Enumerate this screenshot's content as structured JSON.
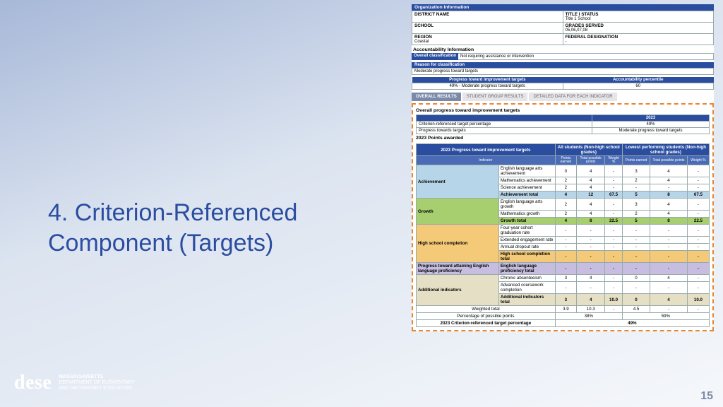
{
  "title": "4. Criterion-Referenced Component (Targets)",
  "page_number": "15",
  "logo": {
    "word": "dese",
    "line1": "MASSACHUSETTS",
    "line2": "Department of Elementary",
    "line3": "and Secondary Education"
  },
  "org": {
    "header": "Organization Information",
    "rows": [
      {
        "l": "DISTRICT NAME",
        "lv": "",
        "r": "TITLE I STATUS",
        "rv": "Title 1 School"
      },
      {
        "l": "SCHOOL",
        "lv": "",
        "r": "GRADES SERVED",
        "rv": "05,06,07,08"
      },
      {
        "l": "REGION",
        "lv": "Coastal",
        "r": "FEDERAL DESIGNATION",
        "rv": "-"
      }
    ]
  },
  "acct": {
    "title": "Accountability Information",
    "overall_label": "Overall classification",
    "overall_value": "Not requiring assistance or intervention",
    "reason_label": "Reason for classification",
    "reason_value": "Moderate progress toward targets",
    "col1_hdr": "Progress toward improvement targets",
    "col1_val": "49% - Moderate progress toward targets",
    "col2_hdr": "Accountability percentile",
    "col2_val": "60"
  },
  "tabs": {
    "t1": "OVERALL RESULTS",
    "t2": "STUDENT GROUP RESULTS",
    "t3": "DETAILED DATA FOR EACH INDICATOR"
  },
  "overall": {
    "title": "Overall progress toward improvement targets",
    "year": "2023",
    "r1_label": "Criterion-referenced target percentage",
    "r1_val": "49%",
    "r2_label": "Progress towards targets",
    "r2_val": "Moderate progress toward targets"
  },
  "points_title": "2023 Points awarded",
  "pts": {
    "main_hdr": "2023 Progress toward improvement targets",
    "indicator": "Indicator",
    "grp1": "All students\n(Non-high school grades)",
    "grp2": "Lowest performing students\n(Non-high school grades)",
    "cols": [
      "Points earned",
      "Total possible points",
      "Weight %",
      "Points earned",
      "Total possible points",
      "Weight %"
    ],
    "cats": {
      "ach": {
        "name": "Achievement",
        "rows": [
          {
            "n": "English language arts achievement",
            "v": [
              "0",
              "4",
              "-",
              "3",
              "4",
              "-"
            ]
          },
          {
            "n": "Mathematics achievement",
            "v": [
              "2",
              "4",
              "-",
              "2",
              "4",
              "-"
            ]
          },
          {
            "n": "Science achievement",
            "v": [
              "2",
              "4",
              "-",
              "-",
              "-",
              "-"
            ]
          }
        ],
        "total": {
          "n": "Achievement total",
          "v": [
            "4",
            "12",
            "67.5",
            "5",
            "8",
            "67.5"
          ]
        }
      },
      "growth": {
        "name": "Growth",
        "rows": [
          {
            "n": "English language arts growth",
            "v": [
              "2",
              "4",
              "-",
              "3",
              "4",
              "-"
            ]
          },
          {
            "n": "Mathematics growth",
            "v": [
              "2",
              "4",
              "-",
              "2",
              "4",
              "-"
            ]
          }
        ],
        "total": {
          "n": "Growth total",
          "v": [
            "4",
            "8",
            "22.5",
            "5",
            "8",
            "22.5"
          ]
        }
      },
      "hs": {
        "name": "High school completion",
        "rows": [
          {
            "n": "Four-year cohort graduation rate",
            "v": [
              "-",
              "-",
              "-",
              "-",
              "-",
              "-"
            ]
          },
          {
            "n": "Extended engagement rate",
            "v": [
              "-",
              "-",
              "-",
              "-",
              "-",
              "-"
            ]
          },
          {
            "n": "Annual dropout rate",
            "v": [
              "-",
              "-",
              "-",
              "-",
              "-",
              "-"
            ]
          }
        ],
        "total": {
          "n": "High school completion total",
          "v": [
            "-",
            "-",
            "-",
            "-",
            "-",
            "-"
          ]
        }
      },
      "elp": {
        "name": "Progress toward attaining English language proficiency",
        "total": {
          "n": "English language proficiency total",
          "v": [
            "-",
            "-",
            "-",
            "-",
            "-",
            "-"
          ]
        }
      },
      "add": {
        "name": "Additional indicators",
        "rows": [
          {
            "n": "Chronic absenteeism",
            "v": [
              "3",
              "4",
              "-",
              "0",
              "4",
              "-"
            ]
          },
          {
            "n": "Advanced coursework completion",
            "v": [
              "-",
              "-",
              "-",
              "-",
              "-",
              "-"
            ]
          }
        ],
        "total": {
          "n": "Additional indicators total",
          "v": [
            "3",
            "4",
            "10.0",
            "0",
            "4",
            "10.0"
          ]
        }
      }
    },
    "weighted": {
      "n": "Weighted total",
      "v": [
        "3.9",
        "10.3",
        "-",
        "4.5",
        "-",
        "-"
      ]
    },
    "pct_possible": {
      "n": "Percentage of possible points",
      "a": "38%",
      "b": "59%"
    },
    "final": {
      "n": "2023 Criterion-referenced target percentage",
      "v": "49%"
    }
  }
}
